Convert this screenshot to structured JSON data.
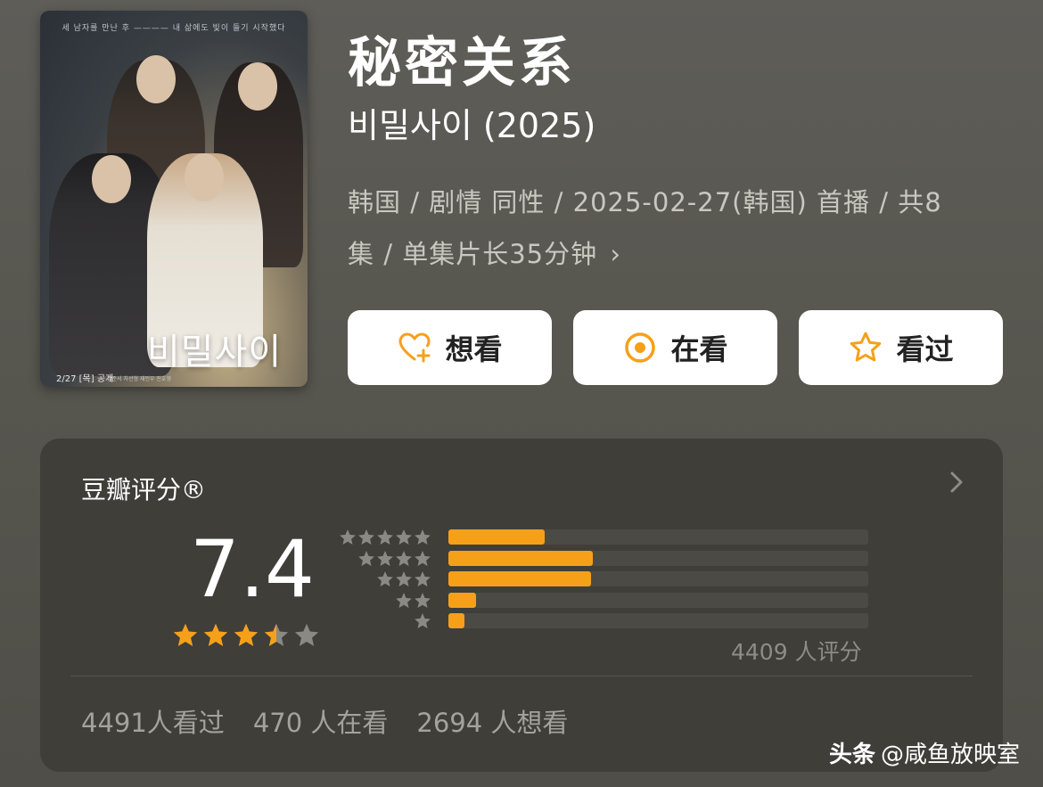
{
  "poster": {
    "tagline": "세 남자를 만난 후 ———— 내 삶에도 빛이 들기 시작했다",
    "title": "비밀사이",
    "date": "2/27 [목] 공개",
    "credits": "김준서  차선형  재인우  진호영"
  },
  "title": "秘密关系",
  "original_title": "비밀사이 (2025)",
  "meta": {
    "line1": "韩国 / 剧情 同性 / 2025-02-27(韩国) 首播 / 共8",
    "line2": "集 / 单集片长35分钟",
    "chevron": "›"
  },
  "actions": [
    {
      "label": "想看",
      "icon": "heart-plus-icon"
    },
    {
      "label": "在看",
      "icon": "target-icon"
    },
    {
      "label": "看过",
      "icon": "star-outline-icon"
    }
  ],
  "rating": {
    "header": "豆瓣评分®",
    "score": "7.4",
    "stars_value": 3.5,
    "distribution": [
      {
        "stars": 5,
        "fraction": 0.23
      },
      {
        "stars": 4,
        "fraction": 0.345
      },
      {
        "stars": 3,
        "fraction": 0.34
      },
      {
        "stars": 2,
        "fraction": 0.065
      },
      {
        "stars": 1,
        "fraction": 0.038
      }
    ],
    "raters": "4409 人评分"
  },
  "counts": {
    "watched": "4491人看过",
    "watching": "470 人在看",
    "want": "2694 人想看"
  },
  "watermark": {
    "brand": "头条",
    "handle": "@咸鱼放映室"
  },
  "colors": {
    "accent": "#f6a01a",
    "card_bg": "#3f3e39",
    "track": "#4b4a45",
    "star_gray": "#8a8983"
  }
}
